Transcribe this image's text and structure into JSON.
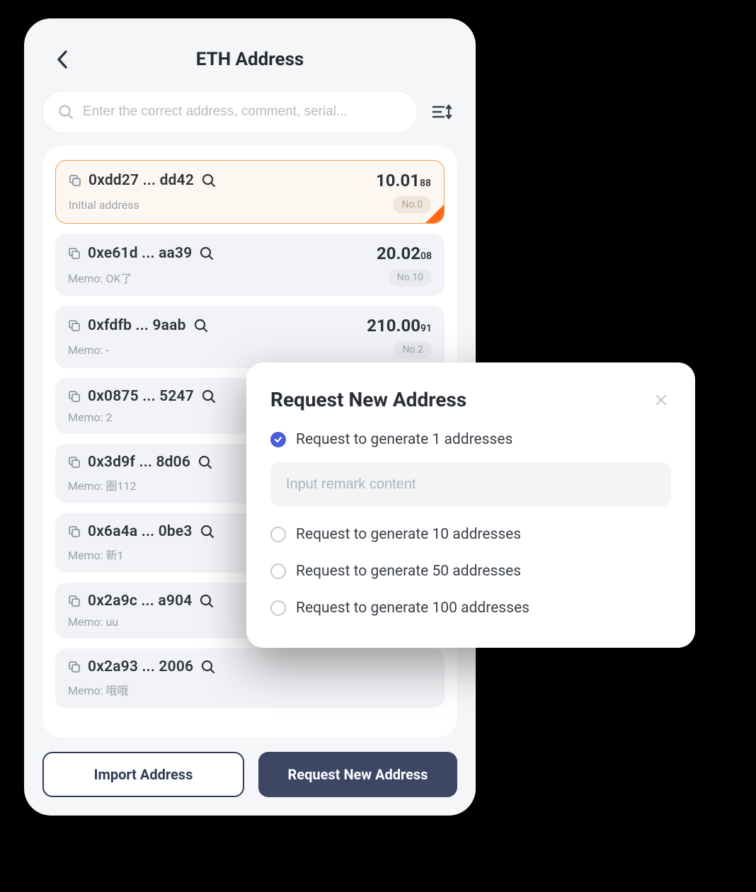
{
  "header": {
    "title": "ETH Address"
  },
  "search": {
    "placeholder": "Enter the correct address, comment, serial..."
  },
  "addresses": [
    {
      "addr": "0xdd27 ... dd42",
      "balance_main": "10.01",
      "balance_dec": "88",
      "memo": "Initial address",
      "no": "No.0",
      "selected": true
    },
    {
      "addr": "0xe61d ... aa39",
      "balance_main": "20.02",
      "balance_dec": "08",
      "memo": "Memo: OK了",
      "no": "No.10",
      "selected": false
    },
    {
      "addr": "0xfdfb ... 9aab",
      "balance_main": "210.00",
      "balance_dec": "91",
      "memo": "Memo: -",
      "no": "No.2",
      "selected": false
    },
    {
      "addr": "0x0875 ... 5247",
      "balance_main": "",
      "balance_dec": "",
      "memo": "Memo: 2",
      "no": "",
      "selected": false
    },
    {
      "addr": "0x3d9f ... 8d06",
      "balance_main": "",
      "balance_dec": "",
      "memo": "Memo: 圈112",
      "no": "",
      "selected": false
    },
    {
      "addr": "0x6a4a ... 0be3",
      "balance_main": "",
      "balance_dec": "",
      "memo": "Memo: 新1",
      "no": "",
      "selected": false
    },
    {
      "addr": "0x2a9c ... a904",
      "balance_main": "",
      "balance_dec": "",
      "memo": "Memo: uu",
      "no": "",
      "selected": false
    },
    {
      "addr": "0x2a93 ... 2006",
      "balance_main": "",
      "balance_dec": "",
      "memo": "Memo: 哦哦",
      "no": "",
      "selected": false
    }
  ],
  "footer": {
    "import_label": "Import Address",
    "request_label": "Request New Address"
  },
  "modal": {
    "title": "Request New Address",
    "remark_placeholder": "Input remark content",
    "options": [
      {
        "label": "Request to generate 1 addresses",
        "checked": true
      },
      {
        "label": "Request to generate 10 addresses",
        "checked": false
      },
      {
        "label": "Request to generate 50 addresses",
        "checked": false
      },
      {
        "label": "Request to generate 100 addresses",
        "checked": false
      }
    ]
  }
}
